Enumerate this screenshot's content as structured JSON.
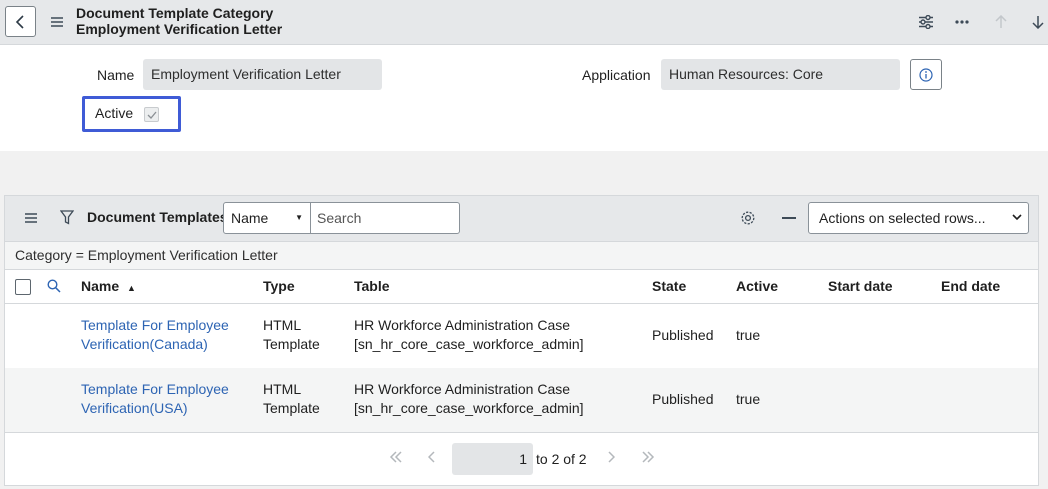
{
  "header": {
    "title_line1": "Document Template Category",
    "title_line2": "Employment Verification Letter"
  },
  "form": {
    "name_label": "Name",
    "name_value": "Employment Verification Letter",
    "application_label": "Application",
    "application_value": "Human Resources: Core",
    "active_label": "Active",
    "active_checked": true
  },
  "list": {
    "title": "Document Templates",
    "search_field": "Name",
    "search_placeholder": "Search",
    "actions_label": "Actions on selected rows...",
    "filter_text": "Category = Employment Verification Letter",
    "columns": [
      "Name",
      "Type",
      "Table",
      "State",
      "Active",
      "Start date",
      "End date"
    ],
    "sort_column": "Name",
    "rows": [
      {
        "name_line1": "Template For Employee",
        "name_line2": "Verification(Canada)",
        "type_line1": "HTML",
        "type_line2": "Template",
        "table_line1": "HR Workforce Administration Case",
        "table_line2": "[sn_hr_core_case_workforce_admin]",
        "state": "Published",
        "active": "true",
        "start_date": "",
        "end_date": ""
      },
      {
        "name_line1": "Template For Employee",
        "name_line2": "Verification(USA)",
        "type_line1": "HTML",
        "type_line2": "Template",
        "table_line1": "HR Workforce Administration Case",
        "table_line2": "[sn_hr_core_case_workforce_admin]",
        "state": "Published",
        "active": "true",
        "start_date": "",
        "end_date": ""
      }
    ]
  },
  "pagination": {
    "current_page": "1",
    "range_text": "to 2 of 2"
  },
  "colors": {
    "link": "#2d64b3",
    "focus_outline": "#3f5bd6",
    "header_bg": "#e6e8ea",
    "row_alt_bg": "#f4f5f5"
  },
  "icons": [
    "back-icon",
    "menu-icon",
    "settings-sliders-icon",
    "more-icon",
    "up-arrow-icon",
    "down-arrow-icon",
    "info-icon",
    "filter-icon",
    "gear-icon",
    "minus-icon",
    "search-icon",
    "sort-ascending-icon",
    "first-page-icon",
    "prev-page-icon",
    "next-page-icon",
    "last-page-icon"
  ]
}
